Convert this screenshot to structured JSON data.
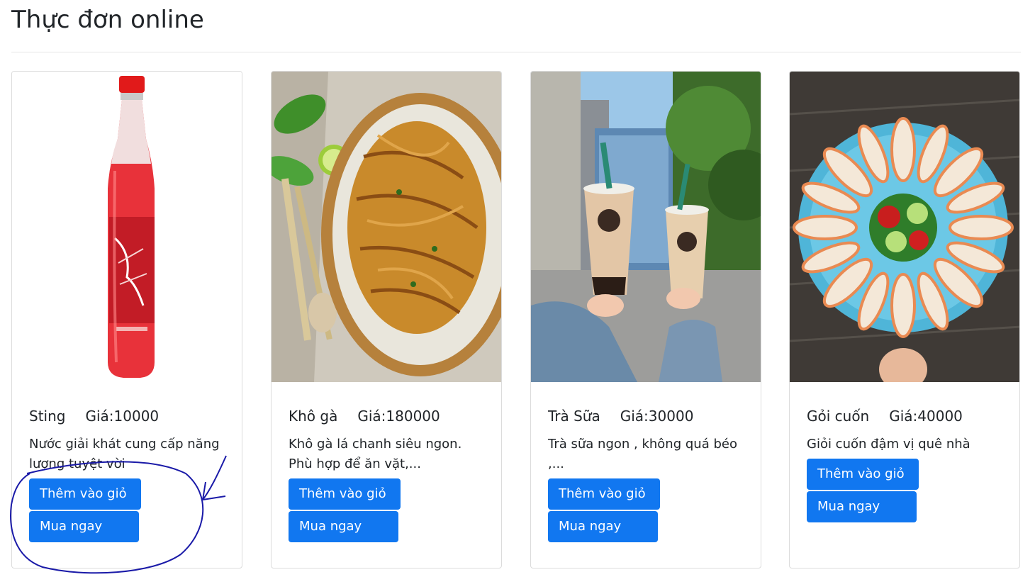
{
  "page": {
    "title": "Thực đơn online"
  },
  "colors": {
    "button": "#1177f0",
    "annotation": "#1a1aa8"
  },
  "products": [
    {
      "name": "Sting",
      "price": "Giá:10000",
      "description": "Nước giải khát cung cấp năng lượng tuyệt vời",
      "image": "red-bottle-image",
      "add_label": "Thêm vào giỏ",
      "buy_label": "Mua ngay"
    },
    {
      "name": "Khô gà",
      "price": "Giá:180000",
      "description": "Khô gà lá chanh siêu ngon. Phù hợp để ăn vặt,...",
      "image": "dried-chicken-image",
      "add_label": "Thêm vào giỏ",
      "buy_label": "Mua ngay"
    },
    {
      "name": "Trà Sữa",
      "price": "Giá:30000",
      "description": "Trà sữa ngon , không quá béo ,...",
      "image": "milk-tea-image",
      "add_label": "Thêm vào giỏ",
      "buy_label": "Mua ngay"
    },
    {
      "name": "Gỏi cuốn",
      "price": "Giá:40000",
      "description": "Giỏi cuốn đậm vị quê nhà",
      "image": "spring-rolls-image",
      "add_label": "Thêm vào giỏ",
      "buy_label": "Mua ngay"
    }
  ]
}
